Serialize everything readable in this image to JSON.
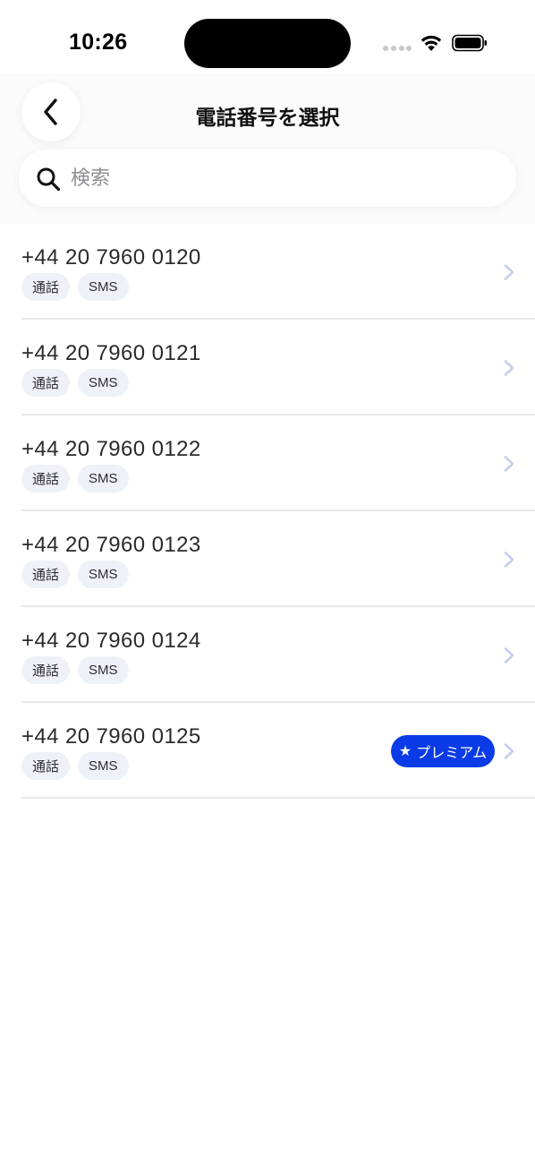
{
  "status_bar": {
    "time": "10:26"
  },
  "header": {
    "title": "電話番号を選択",
    "search_placeholder": "検索"
  },
  "numbers": [
    {
      "number": "+44 20 7960 0120",
      "tags": [
        "通話",
        "SMS"
      ]
    },
    {
      "number": "+44 20 7960 0121",
      "tags": [
        "通話",
        "SMS"
      ]
    },
    {
      "number": "+44 20 7960 0122",
      "tags": [
        "通話",
        "SMS"
      ]
    },
    {
      "number": "+44 20 7960 0123",
      "tags": [
        "通話",
        "SMS"
      ]
    },
    {
      "number": "+44 20 7960 0124",
      "tags": [
        "通話",
        "SMS"
      ]
    },
    {
      "number": "+44 20 7960 0125",
      "tags": [
        "通話",
        "SMS"
      ],
      "badge": "プレミアム"
    }
  ],
  "badge_star": "★",
  "icons": {
    "back": "chevron-left-icon",
    "search": "search-icon",
    "row_arrow": "chevron-right-icon",
    "wifi": "wifi-icon",
    "battery": "battery-icon",
    "signal": "signal-icon"
  },
  "colors": {
    "accent": "#0a3be6",
    "chevron": "#c3cfee",
    "tag_bg": "#eef1f8",
    "divider": "#e9e9ec"
  }
}
